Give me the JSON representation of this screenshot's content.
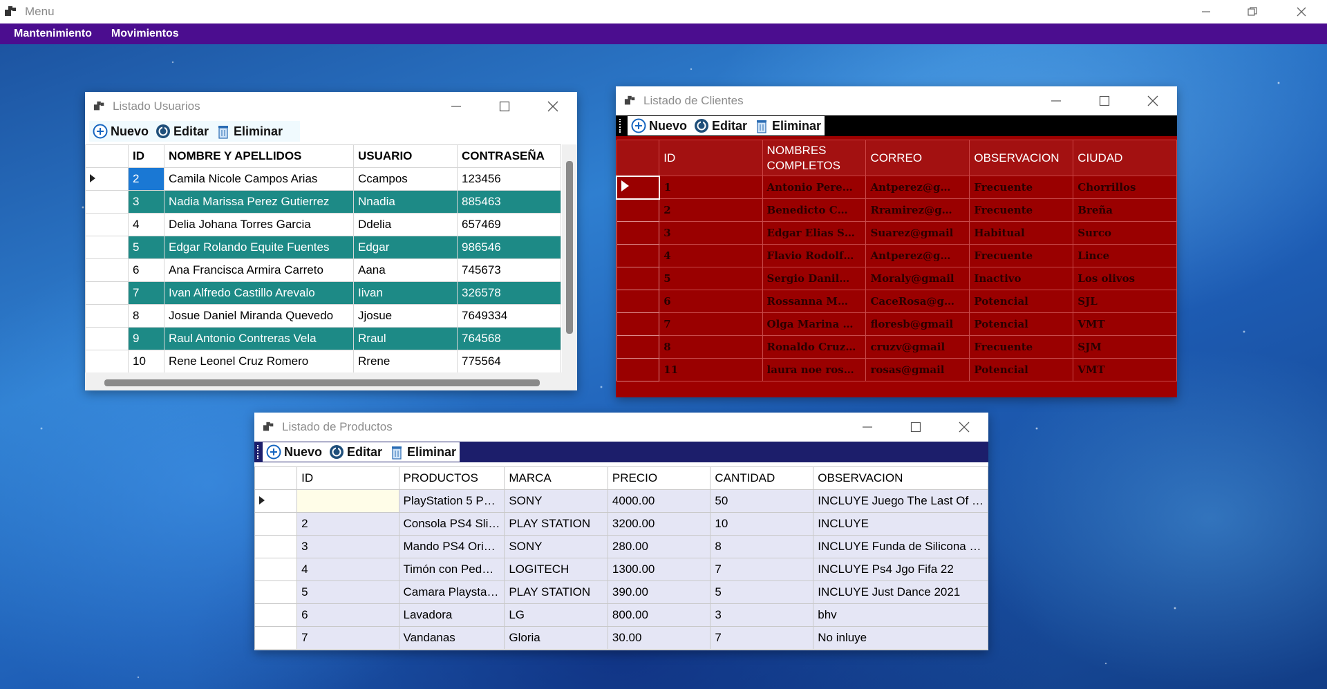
{
  "window": {
    "title": "Menu"
  },
  "menu": {
    "items": [
      "Mantenimiento",
      "Movimientos"
    ]
  },
  "toolbar": {
    "new_label": "Nuevo",
    "edit_label": "Editar",
    "delete_label": "Eliminar"
  },
  "users": {
    "title": "Listado Usuarios",
    "columns": [
      "ID",
      "NOMBRE Y APELLIDOS",
      "USUARIO",
      "CONTRASEÑA"
    ],
    "rows": [
      [
        "2",
        "Camila Nicole Campos Arias",
        "Ccampos",
        "123456"
      ],
      [
        "3",
        "Nadia Marissa Perez Gutierrez",
        "Nnadia",
        "885463"
      ],
      [
        "4",
        "Delia Johana Torres Garcia",
        "Ddelia",
        "657469"
      ],
      [
        "5",
        "Edgar Rolando Equite Fuentes",
        "Edgar",
        "986546"
      ],
      [
        "6",
        "Ana Francisca Armira Carreto",
        "Aana",
        "745673"
      ],
      [
        "7",
        "Ivan Alfredo Castillo Arevalo",
        "Iivan",
        "326578"
      ],
      [
        "8",
        "Josue Daniel Miranda Quevedo",
        "Jjosue",
        "7649334"
      ],
      [
        "9",
        "Raul Antonio Contreras Vela",
        "Rraul",
        "764568"
      ],
      [
        "10",
        "Rene Leonel Cruz Romero",
        "Rrene",
        "775564"
      ]
    ],
    "accent_color": "#1d8a86"
  },
  "clients": {
    "title": "Listado de Clientes",
    "columns": [
      "ID",
      "NOMBRES COMPLETOS",
      "CORREO",
      "OBSERVACION",
      "CIUDAD"
    ],
    "rows": [
      [
        "1",
        "Antonio Pere…",
        "Antperez@g…",
        "Frecuente",
        "Chorrillos"
      ],
      [
        "2",
        "Benedicto  C…",
        "Rramirez@g…",
        "Frecuente",
        "Breña"
      ],
      [
        "3",
        "Edgar Elias S…",
        "Suarez@gmail",
        "Habitual",
        "Surco"
      ],
      [
        "4",
        "Flavio Rodolf…",
        "Antperez@g…",
        "Frecuente",
        "Lince"
      ],
      [
        "5",
        "Sergio Danil…",
        "Moraly@gmail",
        "Inactivo",
        "Los olivos"
      ],
      [
        "6",
        " Rossanna M…",
        "CaceRosa@g…",
        "Potencial",
        "SJL"
      ],
      [
        "7",
        "Olga Marina …",
        "floresb@gmail",
        "Potencial",
        "VMT"
      ],
      [
        "8",
        "Ronaldo Cruz…",
        "cruzv@gmail",
        "Frecuente",
        "SJM"
      ],
      [
        "11",
        "laura noe ros…",
        "rosas@gmail",
        "Potencial",
        "VMT"
      ]
    ],
    "accent_color": "#9a0000"
  },
  "products": {
    "title": "Listado de Productos",
    "columns": [
      "ID",
      "PRODUCTOS",
      "MARCA",
      "PRECIO",
      "CANTIDAD",
      "OBSERVACION"
    ],
    "rows": [
      [
        "",
        "PlayStation 5 P…",
        "SONY",
        "4000.00",
        "50",
        "INCLUYE Juego The Last Of …"
      ],
      [
        "2",
        "Consola PS4 Sli…",
        "PLAY STATION",
        "3200.00",
        "10",
        "INCLUYE"
      ],
      [
        "3",
        "Mando PS4 Ori…",
        "SONY",
        "280.00",
        "8",
        "INCLUYE Funda de Silicona …"
      ],
      [
        "4",
        "Timón con Ped…",
        "LOGITECH",
        "1300.00",
        "7",
        "INCLUYE Ps4 Jgo Fifa 22"
      ],
      [
        "5",
        "Camara Playsta…",
        "PLAY STATION",
        "390.00",
        "5",
        "INCLUYE Just Dance 2021"
      ],
      [
        "6",
        "Lavadora",
        "LG",
        "800.00",
        "3",
        "bhv"
      ],
      [
        "7",
        "Vandanas",
        "Gloria",
        "30.00",
        "7",
        "No inluye"
      ]
    ],
    "accent_color": "#1c1e6b"
  },
  "icons": {
    "new": "plus-circle-icon",
    "edit": "refresh-circle-icon",
    "delete": "trash-icon"
  }
}
